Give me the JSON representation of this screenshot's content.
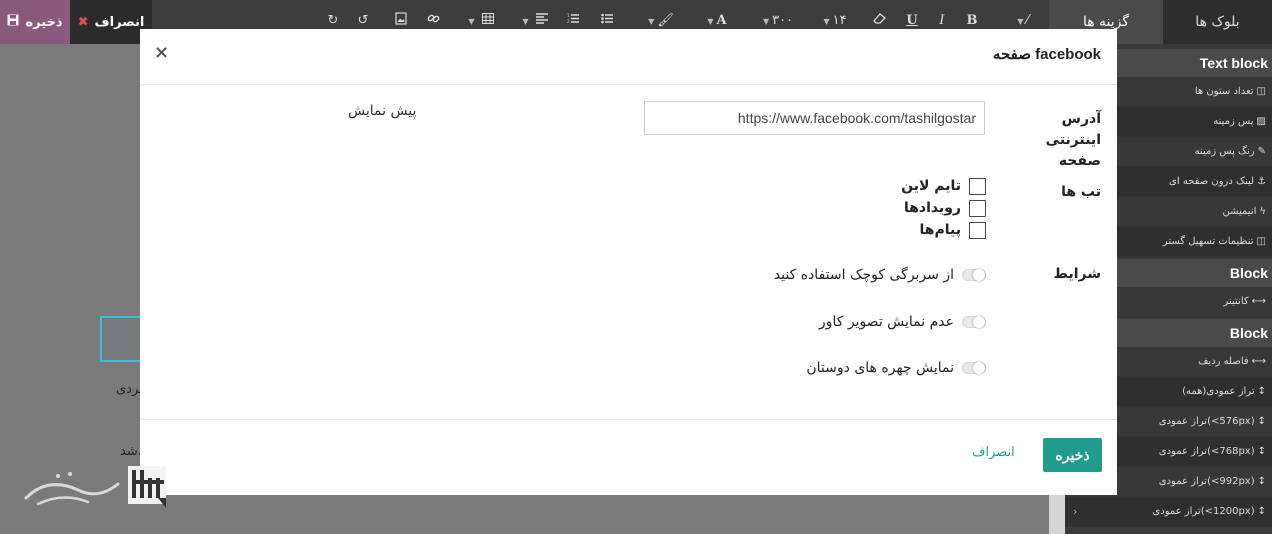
{
  "topbar": {
    "save_label": "ذخیره",
    "discard_label": "انصراف",
    "font_size": "۱۴",
    "line_height": "۳۰۰"
  },
  "panel": {
    "tabs": {
      "blocks": "بلوک ها",
      "options": "گزینه ها"
    },
    "sections": [
      {
        "heading": "Text block",
        "items": [
          "تعداد ستون ها",
          "پس زمینه",
          "رنگ پس زمینه",
          "لینک درون صفحه ای",
          "انیمیشن",
          "تنظیمات تسهیل گستر"
        ]
      },
      {
        "heading": "Block",
        "items": [
          "کانتینر"
        ]
      },
      {
        "heading": "Block",
        "items": [
          "فاصله ردیف",
          "تراز عمودی(همه)",
          "تراز عمودی(<576px)",
          "تراز عمودی(<768px)",
          "تراز عمودی(<992px)",
          "تراز عمودی(<1200px)"
        ]
      }
    ]
  },
  "page": {
    "text1": "فردی",
    "text2": "شد."
  },
  "modal": {
    "title": "صفحه facebook",
    "url_label": "آدرس اینترنتی صفحه",
    "url_value": "https://www.facebook.com/tashilgostar",
    "preview_label": "پیش نمایش",
    "tabs_label": "تب ها",
    "tabs": [
      "تایم لاین",
      "رویدادها",
      "پیام‌ها"
    ],
    "options_label": "شرایط",
    "options": [
      "از سربرگی کوچک استفاده کنید",
      "عدم نمایش تصویر کاور",
      "نمایش چهره های دوستان"
    ],
    "save_label": "ذخیره",
    "cancel_label": "انصراف",
    "close_glyph": "×"
  },
  "colors": {
    "accent": "#1f9c8c",
    "save_bar": "#8a5a7e",
    "panel_bg": "#3a3a3a"
  }
}
